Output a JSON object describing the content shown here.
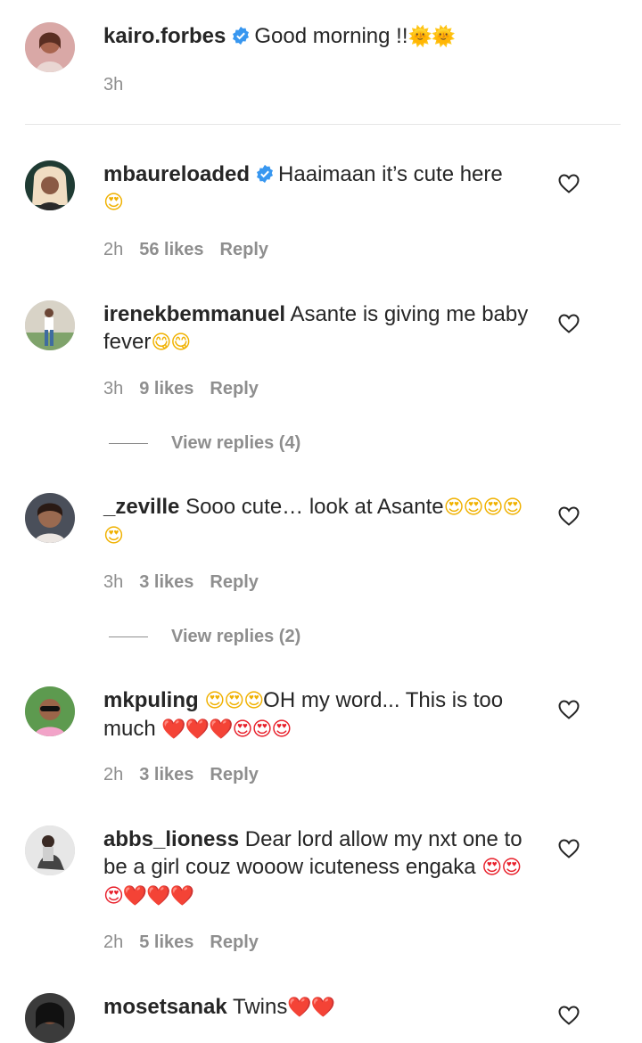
{
  "comments": [
    {
      "username": "kairo.forbes",
      "verified": true,
      "text": "Good morning !!",
      "emoji": "🌞🌞",
      "time": "3h",
      "likes": "",
      "reply": "",
      "has_like_button": false
    },
    {
      "username": "mbaureloaded",
      "verified": true,
      "text": "Haaimaan it’s cute here",
      "emoji": "😍",
      "time": "2h",
      "likes": "56 likes",
      "reply": "Reply",
      "has_like_button": true
    },
    {
      "username": "irenekbemmanuel",
      "verified": false,
      "text": "Asante is giving me baby fever",
      "emoji": "😋😋",
      "time": "3h",
      "likes": "9 likes",
      "reply": "Reply",
      "has_like_button": true,
      "view_replies": "View replies (4)"
    },
    {
      "username": "_zeville",
      "verified": false,
      "text": "Sooo cute… look at Asante",
      "emoji": "😍😍😍😍😍",
      "time": "3h",
      "likes": "3 likes",
      "reply": "Reply",
      "has_like_button": true,
      "view_replies": "View replies (2)"
    },
    {
      "username": "mkpuling",
      "verified": false,
      "text_pre_emoji": "😍😍😍",
      "text": "OH my word... This is too much",
      "emoji": "❤️❤️❤️😍😍😍",
      "time": "2h",
      "likes": "3 likes",
      "reply": "Reply",
      "has_like_button": true
    },
    {
      "username": "abbs_lioness",
      "verified": false,
      "text": "Dear lord allow my nxt one to be a girl couz wooow icuteness engaka",
      "emoji": "😍😍😍❤️❤️❤️",
      "time": "2h",
      "likes": "5 likes",
      "reply": "Reply",
      "has_like_button": true
    },
    {
      "username": "mosetsanak",
      "verified": false,
      "text": "Twins",
      "emoji": "❤️❤️",
      "time": "",
      "likes": "",
      "reply": "",
      "has_like_button": true
    }
  ],
  "colors": {
    "text": "#262626",
    "muted": "#8e8e8e",
    "verified": "#3897f0",
    "divider": "#e6e6e6"
  },
  "icons": {
    "verified": "verified-badge-icon",
    "like": "heart-outline-icon"
  }
}
